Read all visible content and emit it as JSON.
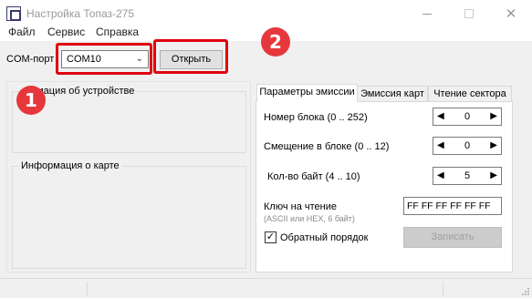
{
  "window": {
    "title": "Настройка Топаз-275",
    "close_glyph": "✕"
  },
  "menu": {
    "items": [
      {
        "label": "Файл"
      },
      {
        "label": "Сервис"
      },
      {
        "label": "Справка"
      }
    ]
  },
  "toolbar": {
    "com_label": "COM-порт",
    "com_value": "COM10",
    "open_button": "Открыть",
    "dropdown_glyph": "⌄"
  },
  "annotations": {
    "badge1": "1",
    "badge2": "2"
  },
  "left_panel": {
    "device_info_title": "рмация об устройстве",
    "card_info_title": "Информация о карте"
  },
  "tabs": [
    {
      "label": "Параметры эмиссии",
      "active": true
    },
    {
      "label": "Эмиссия карт",
      "active": false
    },
    {
      "label": "Чтение сектора",
      "active": false
    }
  ],
  "emission": {
    "block_label": "Номер блока (0 .. 252)",
    "block_value": "0",
    "offset_label": "Смещение в блоке (0 .. 12)",
    "offset_value": "0",
    "bytes_label": "Кол-во байт (4 .. 10)",
    "bytes_value": "5",
    "key_label": "Ключ на чтение",
    "key_hint": "(ASCII или HEX, 6 байт)",
    "key_value": "FF FF FF FF FF FF",
    "reverse_label": "Обратный порядок",
    "reverse_checked": true,
    "check_glyph": "✓",
    "write_button": "Записать",
    "spin_left_glyph": "◀",
    "spin_right_glyph": "▶"
  },
  "colors": {
    "annotation_red": "#e00010",
    "badge_red": "#e6383c"
  }
}
